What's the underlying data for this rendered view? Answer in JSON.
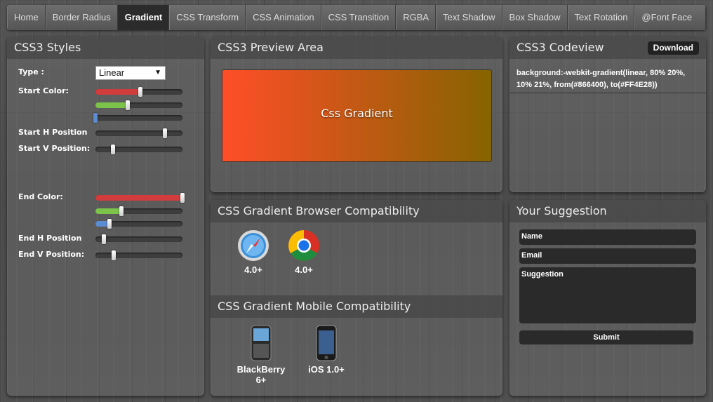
{
  "nav": {
    "tabs": [
      {
        "label": "Home"
      },
      {
        "label": "Border Radius"
      },
      {
        "label": "Gradient"
      },
      {
        "label": "CSS Transform"
      },
      {
        "label": "CSS Animation"
      },
      {
        "label": "CSS Transition"
      },
      {
        "label": "RGBA"
      },
      {
        "label": "Text Shadow"
      },
      {
        "label": "Box Shadow"
      },
      {
        "label": "Text Rotation"
      },
      {
        "label": "@Font Face"
      }
    ],
    "active_tab": "Gradient"
  },
  "styles_panel": {
    "title": "CSS3 Styles",
    "type_label": "Type :",
    "type_value": "Linear",
    "start_color_label": "Start Color:",
    "start_h_label": "Start H Position",
    "start_v_label": "Start V Position:",
    "end_color_label": "End Color:",
    "end_h_label": "End H Position",
    "end_v_label": "End V Position:",
    "levels": {
      "start_red": 0.52,
      "start_green": 0.37,
      "start_blue": 0.0,
      "start_h": 0.8,
      "start_v": 0.2,
      "end_red": 1.0,
      "end_green": 0.3,
      "end_blue": 0.16,
      "end_h": 0.1,
      "end_v": 0.21
    }
  },
  "preview_panel": {
    "title": "CSS3 Preview Area",
    "gradient_text": "Css Gradient",
    "color_from": "#866400",
    "color_to": "#FF4E28"
  },
  "codeview_panel": {
    "title": "CSS3 Codeview",
    "download_label": "Download",
    "code": "background:-webkit-gradient(linear, 80% 20%, 10% 21%, from(#866400), to(#FF4E28))"
  },
  "compat_panel": {
    "browser_title": "CSS Gradient Browser Compatibility",
    "browsers": [
      {
        "icon": "safari-icon",
        "version": "4.0+"
      },
      {
        "icon": "chrome-icon",
        "version": "4.0+"
      }
    ],
    "mobile_title": "CSS Gradient Mobile Compatibility",
    "mobiles": [
      {
        "icon": "blackberry-icon",
        "name": "BlackBerry 6+"
      },
      {
        "icon": "iphone-icon",
        "name": "iOS 1.0+"
      }
    ]
  },
  "suggestion_panel": {
    "title": "Your Suggestion",
    "name_placeholder": "Name",
    "email_placeholder": "Email",
    "suggestion_placeholder": "Suggestion",
    "submit_label": "Submit"
  }
}
